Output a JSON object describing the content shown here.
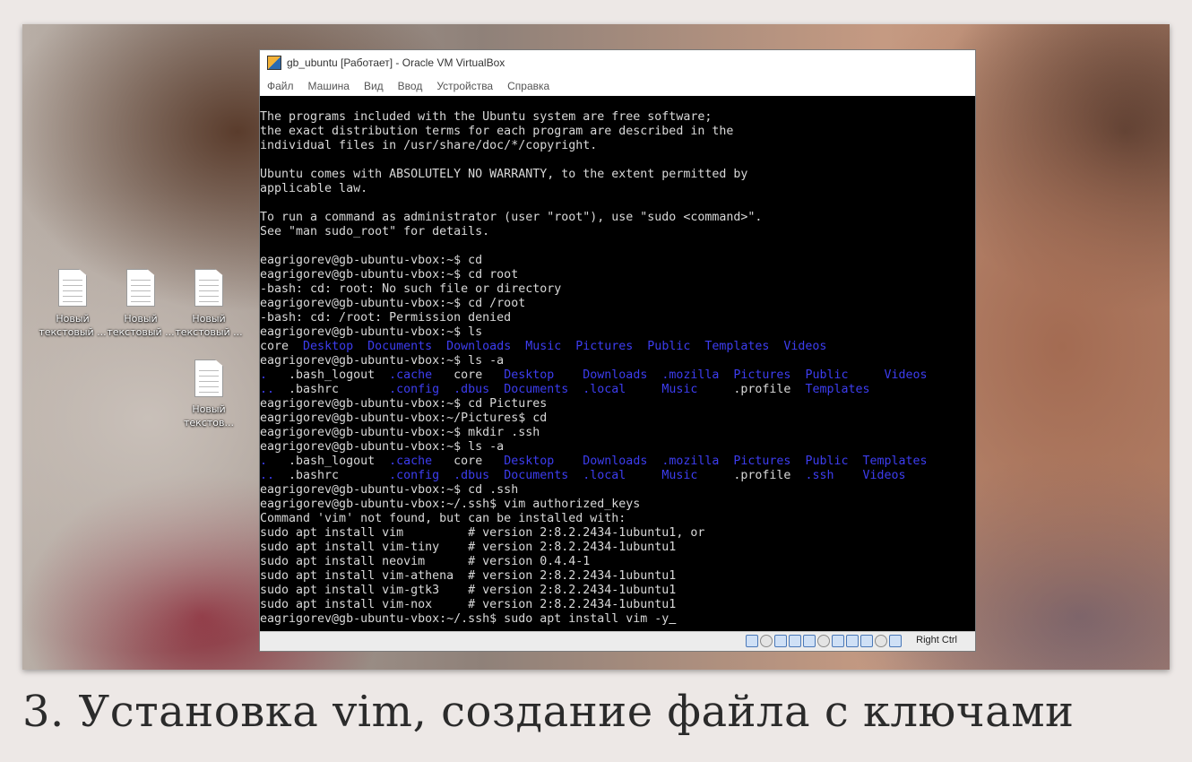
{
  "desktop": {
    "icons": [
      {
        "label1": "Новый",
        "label2": "текстовый ..."
      },
      {
        "label1": "Новый",
        "label2": "текстовый ..."
      },
      {
        "label1": "Новый",
        "label2": "текстовый ..."
      },
      {
        "label1": "Новый",
        "label2": "текстов..."
      }
    ]
  },
  "window": {
    "title": "gb_ubuntu [Работает] - Oracle VM VirtualBox",
    "menu": [
      "Файл",
      "Машина",
      "Вид",
      "Ввод",
      "Устройства",
      "Справка"
    ],
    "host_key": "Right Ctrl"
  },
  "terminal": {
    "lines": [
      [
        {
          "t": "The programs included with the Ubuntu system are free software;"
        }
      ],
      [
        {
          "t": "the exact distribution terms for each program are described in the"
        }
      ],
      [
        {
          "t": "individual files in /usr/share/doc/*/copyright."
        }
      ],
      [
        {
          "t": ""
        }
      ],
      [
        {
          "t": "Ubuntu comes with ABSOLUTELY NO WARRANTY, to the extent permitted by"
        }
      ],
      [
        {
          "t": "applicable law."
        }
      ],
      [
        {
          "t": ""
        }
      ],
      [
        {
          "t": "To run a command as administrator (user \"root\"), use \"sudo <command>\"."
        }
      ],
      [
        {
          "t": "See \"man sudo_root\" for details."
        }
      ],
      [
        {
          "t": ""
        }
      ],
      [
        {
          "t": "eagrigorev@gb-ubuntu-vbox:~$ cd"
        }
      ],
      [
        {
          "t": "eagrigorev@gb-ubuntu-vbox:~$ cd root"
        }
      ],
      [
        {
          "t": "-bash: cd: root: No such file or directory"
        }
      ],
      [
        {
          "t": "eagrigorev@gb-ubuntu-vbox:~$ cd /root"
        }
      ],
      [
        {
          "t": "-bash: cd: /root: Permission denied"
        }
      ],
      [
        {
          "t": "eagrigorev@gb-ubuntu-vbox:~$ ls"
        }
      ],
      [
        {
          "t": "core  "
        },
        {
          "t": "Desktop  Documents  Downloads  Music  Pictures  Public  Templates  Videos",
          "c": "d"
        }
      ],
      [
        {
          "t": "eagrigorev@gb-ubuntu-vbox:~$ ls -a"
        }
      ],
      [
        {
          "t": ".",
          "c": "d"
        },
        {
          "t": "   .bash_logout  "
        },
        {
          "t": ".cache",
          "c": "d"
        },
        {
          "t": "   core   "
        },
        {
          "t": "Desktop    Downloads  .mozilla  Pictures  Public     Videos",
          "c": "d"
        }
      ],
      [
        {
          "t": "..",
          "c": "d"
        },
        {
          "t": "  .bashrc       "
        },
        {
          "t": ".config  .dbus  Documents  .local     Music",
          "c": "d"
        },
        {
          "t": "     .profile  "
        },
        {
          "t": "Templates",
          "c": "d"
        }
      ],
      [
        {
          "t": "eagrigorev@gb-ubuntu-vbox:~$ cd Pictures"
        }
      ],
      [
        {
          "t": "eagrigorev@gb-ubuntu-vbox:~/Pictures$ cd"
        }
      ],
      [
        {
          "t": "eagrigorev@gb-ubuntu-vbox:~$ mkdir .ssh"
        }
      ],
      [
        {
          "t": "eagrigorev@gb-ubuntu-vbox:~$ ls -a"
        }
      ],
      [
        {
          "t": ".",
          "c": "d"
        },
        {
          "t": "   .bash_logout  "
        },
        {
          "t": ".cache",
          "c": "d"
        },
        {
          "t": "   core   "
        },
        {
          "t": "Desktop    Downloads  .mozilla  Pictures  Public  Templates",
          "c": "d"
        }
      ],
      [
        {
          "t": "..",
          "c": "d"
        },
        {
          "t": "  .bashrc       "
        },
        {
          "t": ".config  .dbus  Documents  .local     Music",
          "c": "d"
        },
        {
          "t": "     .profile  "
        },
        {
          "t": ".ssh    Videos",
          "c": "d"
        }
      ],
      [
        {
          "t": "eagrigorev@gb-ubuntu-vbox:~$ cd .ssh"
        }
      ],
      [
        {
          "t": "eagrigorev@gb-ubuntu-vbox:~/.ssh$ vim authorized_keys"
        }
      ],
      [
        {
          "t": "Command 'vim' not found, but can be installed with:"
        }
      ],
      [
        {
          "t": "sudo apt install vim         # version 2:8.2.2434-1ubuntu1, or"
        }
      ],
      [
        {
          "t": "sudo apt install vim-tiny    # version 2:8.2.2434-1ubuntu1"
        }
      ],
      [
        {
          "t": "sudo apt install neovim      # version 0.4.4-1"
        }
      ],
      [
        {
          "t": "sudo apt install vim-athena  # version 2:8.2.2434-1ubuntu1"
        }
      ],
      [
        {
          "t": "sudo apt install vim-gtk3    # version 2:8.2.2434-1ubuntu1"
        }
      ],
      [
        {
          "t": "sudo apt install vim-nox     # version 2:8.2.2434-1ubuntu1"
        }
      ],
      [
        {
          "t": "eagrigorev@gb-ubuntu-vbox:~/.ssh$ sudo apt install vim -y"
        },
        {
          "t": " ",
          "c": "cursor"
        }
      ]
    ]
  },
  "caption": "3. Установка vim, создание файла с ключами"
}
